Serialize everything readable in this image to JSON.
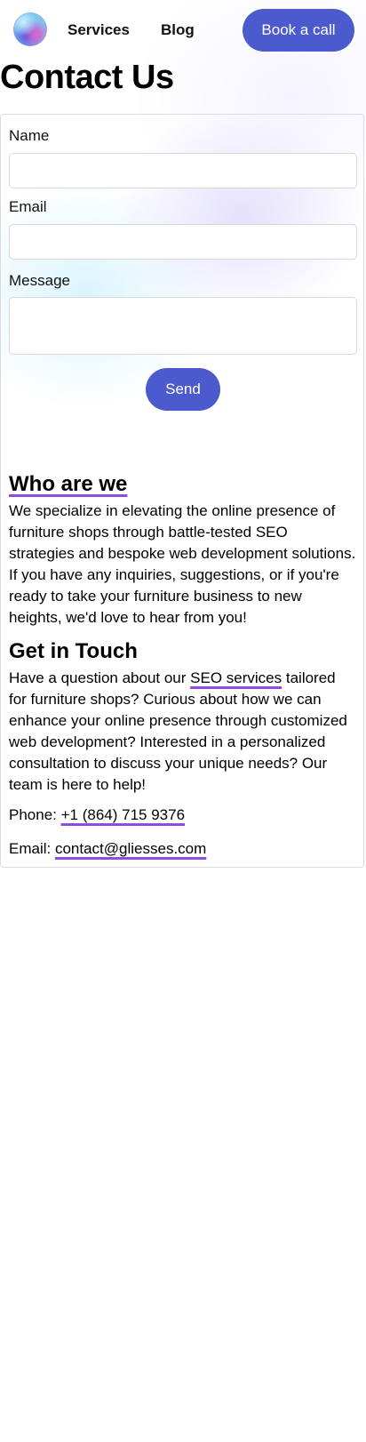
{
  "nav": {
    "links": [
      "Services",
      "Blog"
    ],
    "cta": "Book a call"
  },
  "page": {
    "title": "Contact Us"
  },
  "form": {
    "name_label": "Name",
    "email_label": "Email",
    "message_label": "Message",
    "name_value": "",
    "email_value": "",
    "message_value": "",
    "send_label": "Send"
  },
  "about": {
    "heading": "Who are we",
    "body": "We specialize in elevating the online presence of furniture shops through battle-tested SEO strategies and bespoke web development solutions. If you have any inquiries, suggestions, or if you're ready to take your furniture business to new heights, we'd love to hear from you!"
  },
  "contact": {
    "heading": "Get in Touch",
    "body_before_link": "Have a question about our ",
    "link_text": "SEO services",
    "body_after_link": " tailored for furniture shops? Curious about how we can enhance your online presence through customized web development? Interested in a personalized consultation to discuss your unique needs? Our team is here to help!",
    "phone_label": "Phone: ",
    "phone": "+1 (864) 715 9376",
    "email_label": "Email: ",
    "email": "contact@gliesses.com"
  },
  "theme": {
    "accent": "#4b5acd",
    "underline": "#8e4ce0"
  }
}
